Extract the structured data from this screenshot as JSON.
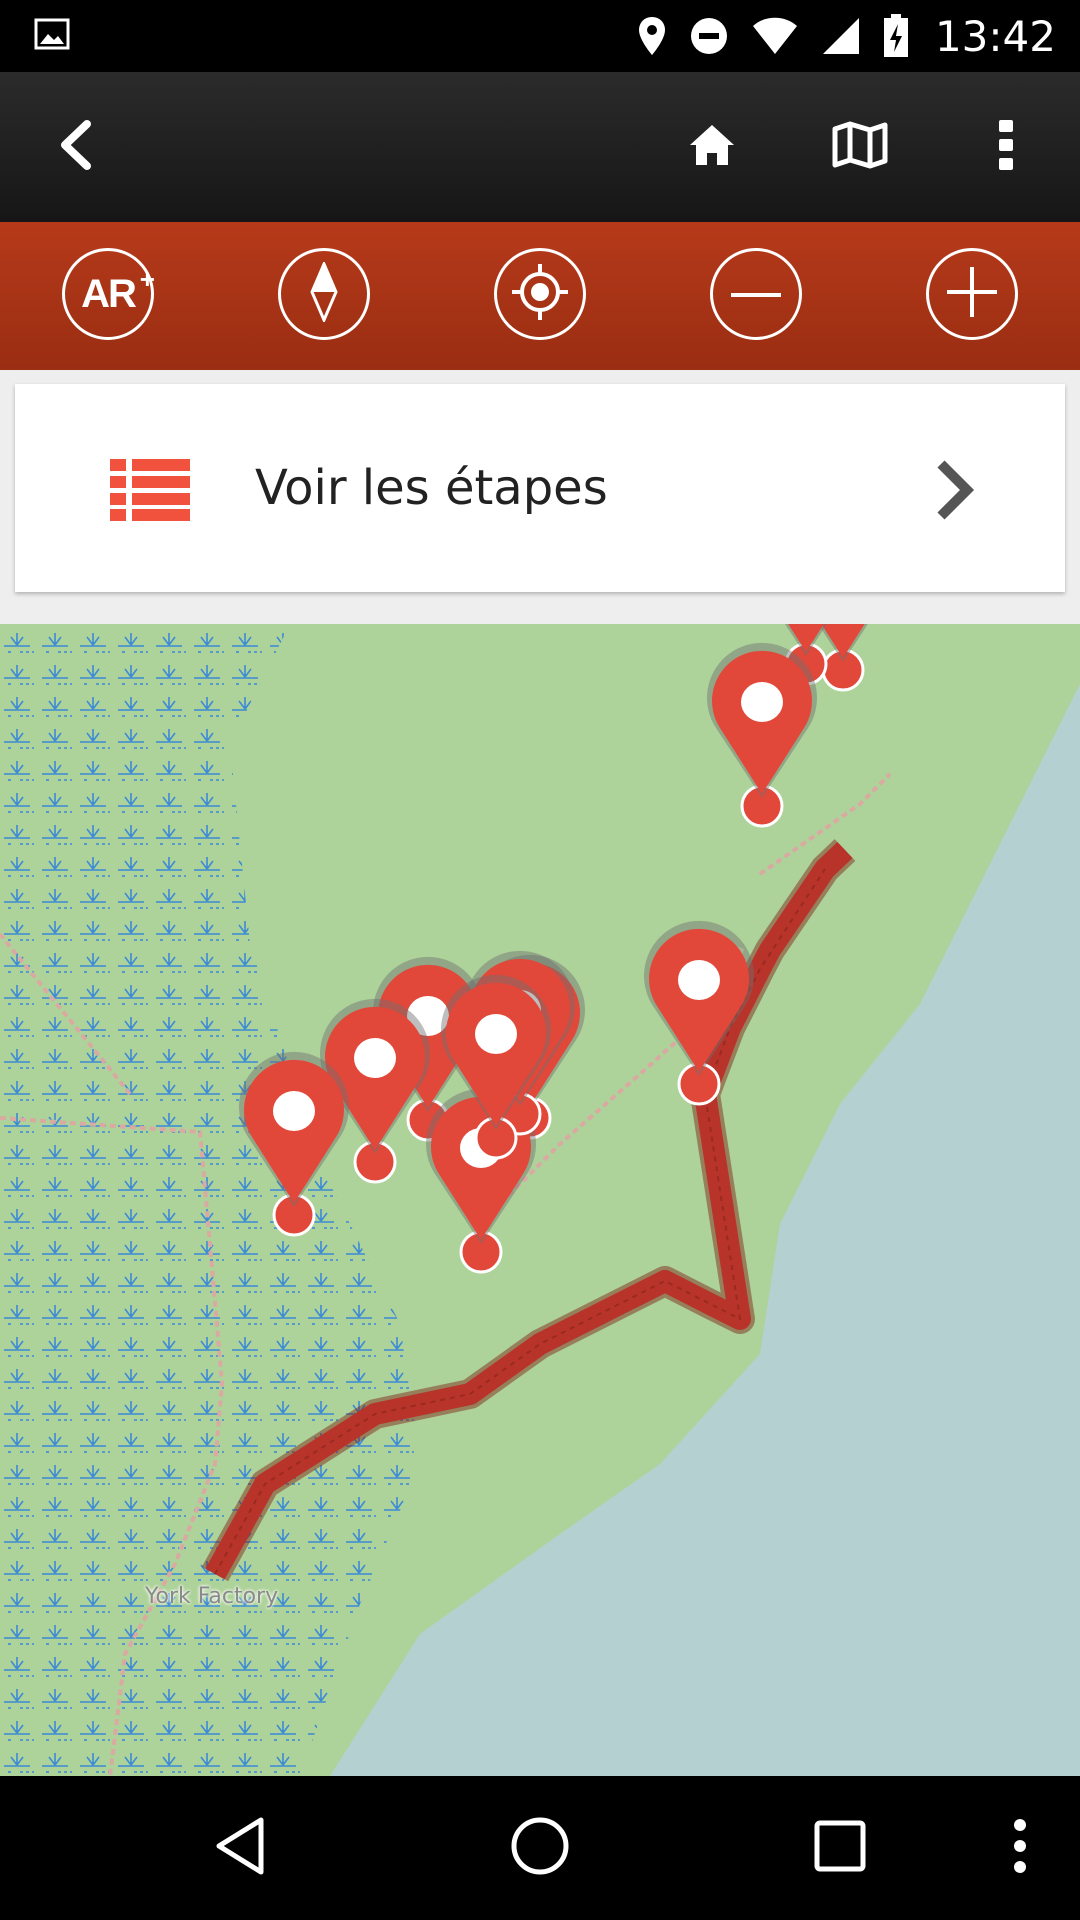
{
  "status_bar": {
    "time": "13:42",
    "icons": [
      "image-icon",
      "location-icon",
      "dnd-icon",
      "wifi-icon",
      "signal-icon",
      "battery-charging-icon"
    ]
  },
  "action_bar": {
    "icons": [
      "back-icon",
      "home-icon",
      "map-icon",
      "overflow-menu-icon"
    ]
  },
  "map_toolbar": {
    "ar_label": "AR",
    "ar_sup": "+",
    "icons": [
      "ar-icon",
      "compass-icon",
      "locate-icon",
      "zoom-out-icon",
      "zoom-in-icon"
    ]
  },
  "steps_card": {
    "label": "Voir les étapes",
    "icon": "list-icon",
    "chevron": "chevron-right-icon"
  },
  "map": {
    "place_label": "York Factory",
    "route_color": "#b8342a",
    "marker_color": "#e2483a",
    "land_color": "#aed39a",
    "water_color": "#b5d0d0",
    "marker_count": 13
  },
  "nav_bar": {
    "icons": [
      "nav-back-icon",
      "nav-home-icon",
      "nav-recents-icon",
      "nav-more-icon"
    ]
  },
  "colors": {
    "toolbar": "#a8321a",
    "actionbar": "#1f1f1f",
    "accent": "#e2483a"
  }
}
